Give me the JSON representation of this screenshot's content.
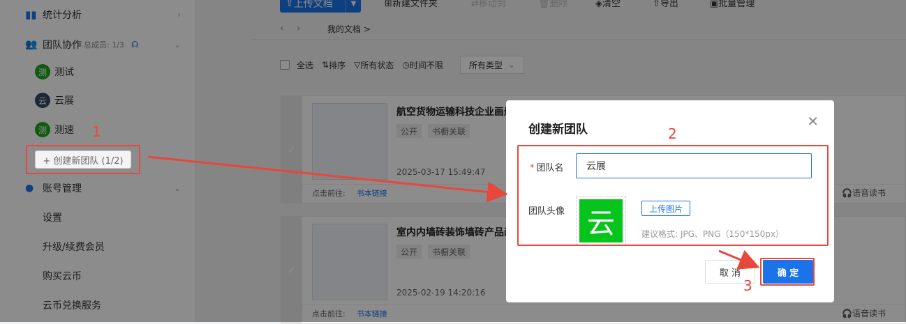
{
  "sidebar": {
    "stats": {
      "label": "统计分析",
      "icon": "bar-chart-icon"
    },
    "team": {
      "label": "团队协作",
      "members": "总成员: 1/3",
      "icon": "team-icon"
    },
    "teams": [
      {
        "name": "测试",
        "avatar": "测",
        "color": "#1fa31f"
      },
      {
        "name": "云展",
        "avatar": "云",
        "color": "#34495e"
      },
      {
        "name": "测速",
        "avatar": "测",
        "color": "#1fa31f"
      }
    ],
    "create_team": "+ 创建新团队 (1/2)",
    "account": {
      "label": "账号管理",
      "icon": "user-icon"
    },
    "account_items": [
      "设置",
      "升级/续费会员",
      "购买云币",
      "云币兑换服务"
    ]
  },
  "toolbar": {
    "upload": "上传文档",
    "new_folder": "新建文件夹",
    "move": "移动到",
    "delete": "删除",
    "clear": "清空",
    "export": "导出",
    "batch": "批量管理"
  },
  "breadcrumb": "我的文档 >",
  "filters": {
    "select_all": "全选",
    "sort": "排序",
    "status": "所有状态",
    "time": "时间不限",
    "type": "所有类型"
  },
  "cards": [
    {
      "title": "航空货物运输科技企业画册",
      "tags": [
        "公开",
        "书橱关联"
      ],
      "date": "2025-03-17 15:49:47",
      "foot_label": "点击前往:",
      "foot_link": "书本链接",
      "right": "语音读书"
    },
    {
      "title": "室内内墙砖装饰墙砖产品画册",
      "tags": [
        "公开",
        "书橱关联"
      ],
      "date": "2025-02-19 14:20:16",
      "foot_label": "点击前往:",
      "foot_link": "书本链接",
      "right": "语音读书"
    }
  ],
  "modal": {
    "title": "创建新团队",
    "name_label": "团队名",
    "name_value": "云展",
    "avatar_label": "团队头像",
    "avatar_char": "云",
    "upload_label": "上传图片",
    "hint": "建议格式: JPG、PNG（150*150px）",
    "cancel": "取 消",
    "ok": "确 定"
  },
  "annotations": {
    "n1": "1",
    "n2": "2",
    "n3": "3"
  },
  "colors": {
    "primary": "#1a73e8",
    "annotation": "#e8473c",
    "avatar_green": "#05c51d"
  }
}
